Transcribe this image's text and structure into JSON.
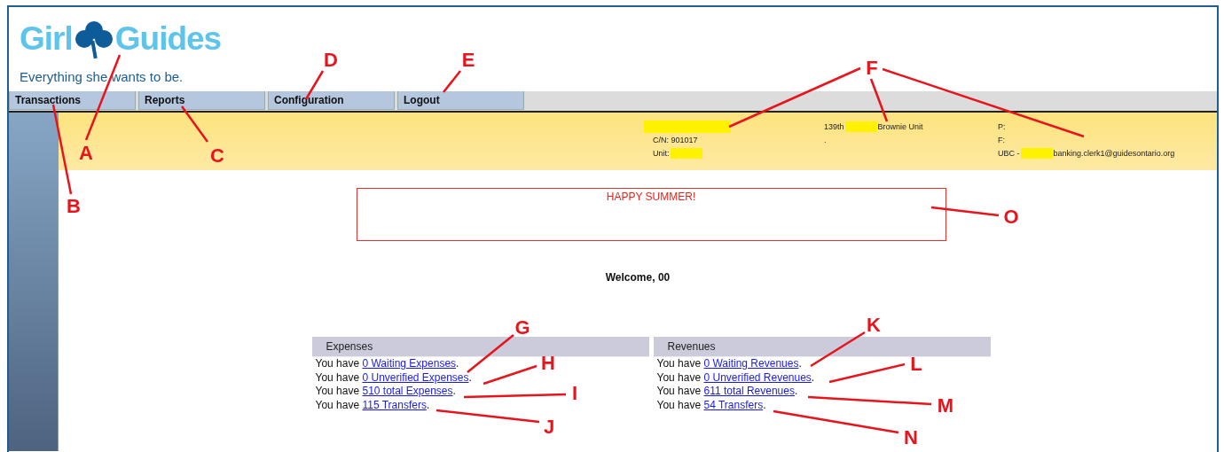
{
  "logo": {
    "word_1": "Girl",
    "word_2": "Guides",
    "tagline": "Everything she wants to be."
  },
  "nav": [
    {
      "label": "Transactions"
    },
    {
      "label": "Reports"
    },
    {
      "label": "Configuration"
    },
    {
      "label": "Logout"
    }
  ],
  "unit_info": [
    {
      "lines": [
        [
          {
            "kind": "redacted"
          }
        ],
        [
          {
            "kind": "text",
            "text": "C/N: 901017"
          }
        ],
        [
          {
            "kind": "text",
            "text": "Unit:"
          },
          {
            "kind": "redacted"
          }
        ]
      ]
    },
    {
      "lines": [
        [
          {
            "kind": "text",
            "text": "139th"
          },
          {
            "kind": "redacted"
          },
          {
            "kind": "text",
            "text": "Brownie Unit"
          }
        ],
        [
          {
            "kind": "text",
            "text": "."
          }
        ]
      ]
    },
    {
      "lines": [
        [
          {
            "kind": "text",
            "text": "P:"
          }
        ],
        [
          {
            "kind": "text",
            "text": "F:"
          }
        ],
        [
          {
            "kind": "text",
            "text": "UBC -"
          },
          {
            "kind": "redacted"
          },
          {
            "kind": "text",
            "text": "banking.clerk1@guidesontario.org"
          }
        ]
      ]
    }
  ],
  "notice": "HAPPY SUMMER!",
  "welcome": "Welcome, 00",
  "panels": [
    {
      "title": "Expenses",
      "lines": [
        {
          "prefix": "You have",
          "link": "0 Waiting Expenses",
          "suffix": "."
        },
        {
          "prefix": "You have",
          "link": "0 Unverified Expenses",
          "suffix": "."
        },
        {
          "prefix": "You have",
          "link": "510 total Expenses",
          "suffix": "."
        },
        {
          "prefix": "You have",
          "link": "115 Transfers",
          "suffix": "."
        }
      ]
    },
    {
      "title": "Revenues",
      "lines": [
        {
          "prefix": "You have",
          "link": "0 Waiting Revenues",
          "suffix": "."
        },
        {
          "prefix": "You have",
          "link": "0 Unverified Revenues",
          "suffix": "."
        },
        {
          "prefix": "You have",
          "link": "611 total Revenues",
          "suffix": "."
        },
        {
          "prefix": "You have",
          "link": "54 Transfers",
          "suffix": "."
        }
      ]
    }
  ],
  "callouts": [
    "A",
    "B",
    "C",
    "D",
    "E",
    "F",
    "G",
    "H",
    "I",
    "J",
    "K",
    "L",
    "M",
    "N",
    "O"
  ]
}
